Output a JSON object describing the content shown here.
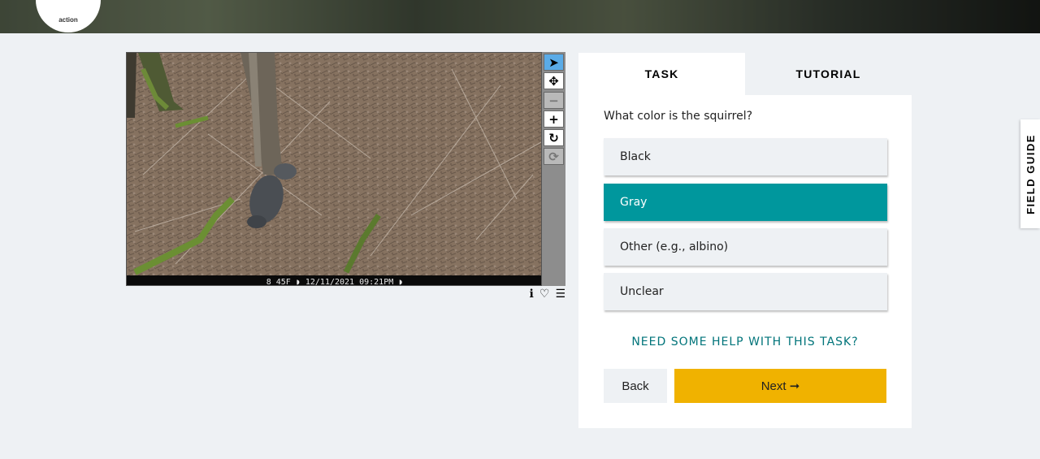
{
  "header": {
    "logo_text": "action"
  },
  "subject": {
    "image_caption": "8 45F  ◗  12/11/2021  09:21PM  ◗"
  },
  "toolbar": {
    "tools": [
      {
        "name": "pointer",
        "glyph": "➤"
      },
      {
        "name": "move",
        "glyph": "✥"
      },
      {
        "name": "zoom-out",
        "glyph": "−"
      },
      {
        "name": "zoom-in",
        "glyph": "+"
      },
      {
        "name": "rotate",
        "glyph": "↻"
      },
      {
        "name": "reset",
        "glyph": "⟳"
      }
    ]
  },
  "meta_icons": {
    "info": "ℹ",
    "favorite": "♡",
    "collections": "☰"
  },
  "panel": {
    "tabs": [
      {
        "label": "TASK",
        "active": true
      },
      {
        "label": "TUTORIAL",
        "active": false
      }
    ],
    "question": "What color is the squirrel?",
    "answers": [
      {
        "label": "Black",
        "selected": false
      },
      {
        "label": "Gray",
        "selected": true
      },
      {
        "label": "Other (e.g., albino)",
        "selected": false
      },
      {
        "label": "Unclear",
        "selected": false
      }
    ],
    "help_link": "NEED SOME HELP WITH THIS TASK?",
    "back_label": "Back",
    "next_label": "Next ➞"
  },
  "field_guide": {
    "label": "FIELD GUIDE"
  },
  "colors": {
    "accent_selected": "#00979d",
    "next_button": "#f0b200",
    "help_link": "#00747a",
    "active_tool": "#5aabe7"
  }
}
